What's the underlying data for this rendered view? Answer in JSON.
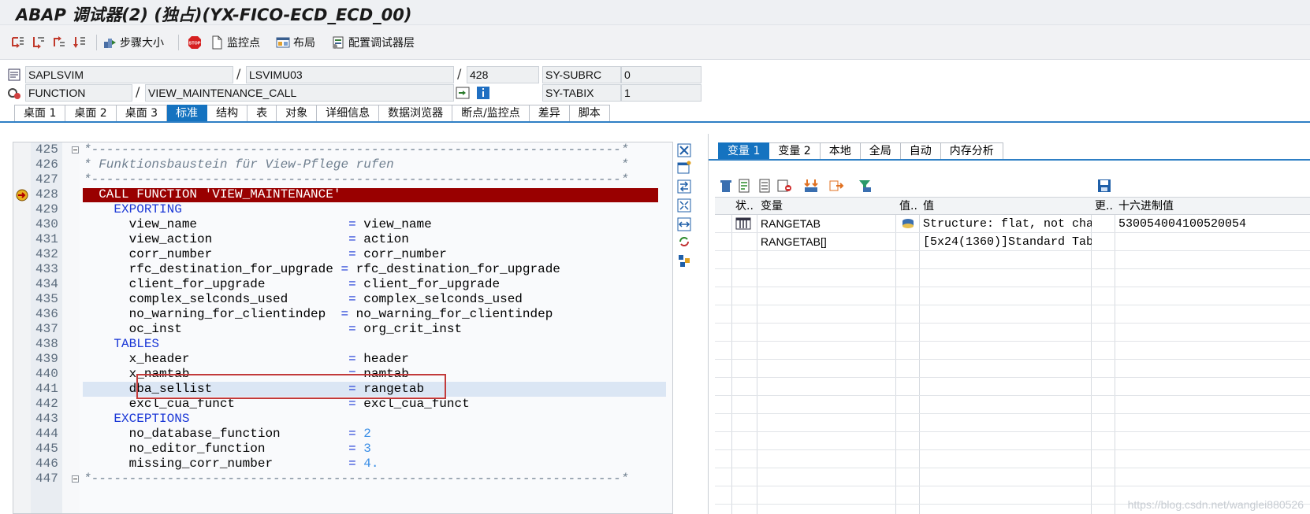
{
  "title": "ABAP 调试器(2) (独占)(YX-FICO-ECD_ECD_00)",
  "toolbar": {
    "step_size": "步骤大小",
    "watchpoint": "监控点",
    "layout": "布局",
    "config_layers": "配置调试器层"
  },
  "header": {
    "program": "SAPLSVIM",
    "include": "LSVIMU03",
    "line": "428",
    "subrc_label": "SY-SUBRC",
    "subrc_value": "0",
    "event_type": "FUNCTION",
    "event_name": "VIEW_MAINTENANCE_CALL",
    "tabix_label": "SY-TABIX",
    "tabix_value": "1",
    "slash": "/"
  },
  "main_tabs": [
    "桌面 1",
    "桌面 2",
    "桌面 3",
    "标准",
    "结构",
    "表",
    "对象",
    "详细信息",
    "数据浏览器",
    "断点/监控点",
    "差异",
    "脚本"
  ],
  "main_tabs_active": "标准",
  "code": {
    "lines": [
      {
        "n": "425",
        "t": "*----------------------------------------------------------------------*",
        "k": "com"
      },
      {
        "n": "426",
        "t": "* Funktionsbaustein für View-Pflege rufen                              *",
        "k": "com"
      },
      {
        "n": "427",
        "t": "*----------------------------------------------------------------------*",
        "k": "com"
      },
      {
        "n": "428",
        "t": "  CALL FUNCTION 'VIEW_MAINTENANCE'",
        "k": "current"
      },
      {
        "n": "429",
        "t": "    EXPORTING",
        "k": "kw"
      },
      {
        "n": "430",
        "t": "      view_name                    = view_name",
        "k": "plain"
      },
      {
        "n": "431",
        "t": "      view_action                  = action",
        "k": "plain"
      },
      {
        "n": "432",
        "t": "      corr_number                  = corr_number",
        "k": "plain"
      },
      {
        "n": "433",
        "t": "      rfc_destination_for_upgrade = rfc_destination_for_upgrade",
        "k": "plain"
      },
      {
        "n": "434",
        "t": "      client_for_upgrade           = client_for_upgrade",
        "k": "plain"
      },
      {
        "n": "435",
        "t": "      complex_selconds_used        = complex_selconds_used",
        "k": "plain"
      },
      {
        "n": "436",
        "t": "      no_warning_for_clientindep  = no_warning_for_clientindep",
        "k": "plain"
      },
      {
        "n": "437",
        "t": "      oc_inst                      = org_crit_inst",
        "k": "plain"
      },
      {
        "n": "438",
        "t": "    TABLES",
        "k": "kw"
      },
      {
        "n": "439",
        "t": "      x_header                     = header",
        "k": "plain"
      },
      {
        "n": "440",
        "t": "      x_namtab                     = namtab",
        "k": "plain"
      },
      {
        "n": "441",
        "t": "      dba_sellist                  = rangetab",
        "k": "sel"
      },
      {
        "n": "442",
        "t": "      excl_cua_funct               = excl_cua_funct",
        "k": "plain"
      },
      {
        "n": "443",
        "t": "    EXCEPTIONS",
        "k": "kw"
      },
      {
        "n": "444",
        "t": "      no_database_function         = ",
        "k": "num",
        "v": "2"
      },
      {
        "n": "445",
        "t": "      no_editor_function           = ",
        "k": "num",
        "v": "3"
      },
      {
        "n": "446",
        "t": "      missing_corr_number          = ",
        "k": "num",
        "v": "4."
      },
      {
        "n": "447",
        "t": "*----------------------------------------------------------------------*",
        "k": "com"
      }
    ]
  },
  "right_tabs": [
    "变量 1",
    "变量 2",
    "本地",
    "全局",
    "自动",
    "内存分析"
  ],
  "right_tabs_active": "变量 1",
  "grid": {
    "headers": {
      "status": "状..",
      "variable": "变量",
      "value_short": "值..",
      "value": "值",
      "change": "更..",
      "hex": "十六进制值"
    },
    "rows": [
      {
        "variable": "RANGETAB",
        "value": "Structure: flat, not cha…",
        "hex": "530054004100520054"
      },
      {
        "variable": "RANGETAB[]",
        "value": "[5x24(1360)]Standard Tab…",
        "hex": ""
      }
    ]
  },
  "watermark": "https://blog.csdn.net/wanglei880526"
}
